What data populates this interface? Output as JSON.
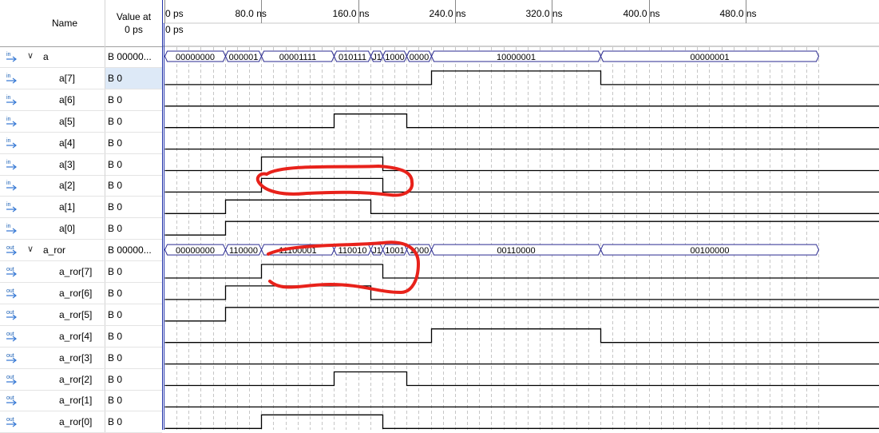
{
  "columns": {
    "name": "Name",
    "value_line1": "Value at",
    "value_line2": "0 ps"
  },
  "timeline": {
    "cursor_label": "0 ps",
    "ticks": [
      {
        "label": "0 ps",
        "t": 0
      },
      {
        "label": "80.0 ns",
        "t": 80
      },
      {
        "label": "160.0 ns",
        "t": 160
      },
      {
        "label": "240.0 ns",
        "t": 240
      },
      {
        "label": "320.0 ns",
        "t": 320
      },
      {
        "label": "400.0 ns",
        "t": 400
      },
      {
        "label": "480.0 ns",
        "t": 480
      }
    ],
    "t_start": 0,
    "t_end": 540
  },
  "signals": [
    {
      "name": "a",
      "value": "B 00000...",
      "dir": "in",
      "bus": true,
      "segments": [
        {
          "from": 0,
          "to": 50,
          "label": "00000000"
        },
        {
          "from": 50,
          "to": 80,
          "label": "000001"
        },
        {
          "from": 80,
          "to": 140,
          "label": "00001111"
        },
        {
          "from": 140,
          "to": 170,
          "label": "010111"
        },
        {
          "from": 170,
          "to": 180,
          "label": "J1"
        },
        {
          "from": 180,
          "to": 200,
          "label": "1000"
        },
        {
          "from": 200,
          "to": 220,
          "label": "0000"
        },
        {
          "from": 220,
          "to": 360,
          "label": "10000001"
        },
        {
          "from": 360,
          "to": 540,
          "label": "00000001"
        }
      ]
    },
    {
      "name": "a[7]",
      "value": "B 0",
      "dir": "in",
      "selected": true,
      "edges": [
        [
          0,
          0
        ],
        [
          220,
          1
        ],
        [
          360,
          0
        ]
      ]
    },
    {
      "name": "a[6]",
      "value": "B 0",
      "dir": "in",
      "edges": [
        [
          0,
          0
        ]
      ]
    },
    {
      "name": "a[5]",
      "value": "B 0",
      "dir": "in",
      "edges": [
        [
          0,
          0
        ],
        [
          140,
          1
        ],
        [
          200,
          0
        ]
      ]
    },
    {
      "name": "a[4]",
      "value": "B 0",
      "dir": "in",
      "edges": [
        [
          0,
          0
        ]
      ]
    },
    {
      "name": "a[3]",
      "value": "B 0",
      "dir": "in",
      "edges": [
        [
          0,
          0
        ],
        [
          80,
          1
        ],
        [
          180,
          0
        ]
      ]
    },
    {
      "name": "a[2]",
      "value": "B 0",
      "dir": "in",
      "edges": [
        [
          0,
          0
        ],
        [
          80,
          1
        ],
        [
          180,
          0
        ]
      ]
    },
    {
      "name": "a[1]",
      "value": "B 0",
      "dir": "in",
      "edges": [
        [
          0,
          0
        ],
        [
          50,
          1
        ],
        [
          170,
          0
        ]
      ]
    },
    {
      "name": "a[0]",
      "value": "B 0",
      "dir": "in",
      "edges": [
        [
          0,
          0
        ],
        [
          50,
          1
        ]
      ]
    },
    {
      "name": "a_ror",
      "value": "B 00000...",
      "dir": "out",
      "bus": true,
      "segments": [
        {
          "from": 0,
          "to": 50,
          "label": "00000000"
        },
        {
          "from": 50,
          "to": 80,
          "label": "110000"
        },
        {
          "from": 80,
          "to": 140,
          "label": "11100001"
        },
        {
          "from": 140,
          "to": 170,
          "label": "110010"
        },
        {
          "from": 170,
          "to": 180,
          "label": "J1"
        },
        {
          "from": 180,
          "to": 200,
          "label": "1001"
        },
        {
          "from": 200,
          "to": 220,
          "label": "1000"
        },
        {
          "from": 220,
          "to": 360,
          "label": "00110000"
        },
        {
          "from": 360,
          "to": 540,
          "label": "00100000"
        }
      ]
    },
    {
      "name": "a_ror[7]",
      "value": "B 0",
      "dir": "out",
      "edges": [
        [
          0,
          0
        ],
        [
          80,
          1
        ],
        [
          180,
          0
        ]
      ]
    },
    {
      "name": "a_ror[6]",
      "value": "B 0",
      "dir": "out",
      "edges": [
        [
          0,
          0
        ],
        [
          50,
          1
        ],
        [
          170,
          0
        ]
      ]
    },
    {
      "name": "a_ror[5]",
      "value": "B 0",
      "dir": "out",
      "edges": [
        [
          0,
          0
        ],
        [
          50,
          1
        ]
      ]
    },
    {
      "name": "a_ror[4]",
      "value": "B 0",
      "dir": "out",
      "edges": [
        [
          0,
          0
        ],
        [
          220,
          1
        ],
        [
          360,
          0
        ]
      ]
    },
    {
      "name": "a_ror[3]",
      "value": "B 0",
      "dir": "out",
      "edges": [
        [
          0,
          0
        ]
      ]
    },
    {
      "name": "a_ror[2]",
      "value": "B 0",
      "dir": "out",
      "edges": [
        [
          0,
          0
        ],
        [
          140,
          1
        ],
        [
          200,
          0
        ]
      ]
    },
    {
      "name": "a_ror[1]",
      "value": "B 0",
      "dir": "out",
      "edges": [
        [
          0,
          0
        ]
      ]
    },
    {
      "name": "a_ror[0]",
      "value": "B 0",
      "dir": "out",
      "edges": [
        [
          0,
          0
        ],
        [
          80,
          1
        ],
        [
          180,
          0
        ]
      ]
    }
  ],
  "annotation_color": "#e8221b",
  "wave_color": "#000000",
  "grid_color": "#b8b8b8",
  "bus_color": "#2a2a90"
}
